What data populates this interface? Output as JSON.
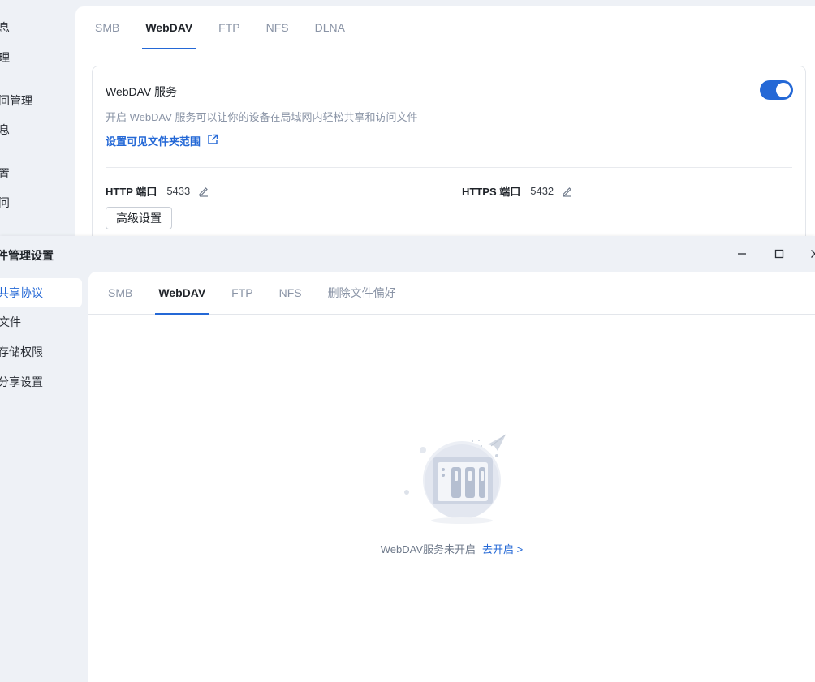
{
  "background_window": {
    "sidebar_items": [
      "息",
      "理",
      "间管理",
      "息",
      "置",
      "问"
    ],
    "tabs": [
      "SMB",
      "WebDAV",
      "FTP",
      "NFS",
      "DLNA"
    ],
    "active_tab": "WebDAV",
    "service": {
      "title": "WebDAV 服务",
      "description": "开启 WebDAV 服务可以让你的设备在局域网内轻松共享和访问文件",
      "folder_link": "设置可见文件夹范围",
      "enabled": true
    },
    "http_port": {
      "label": "HTTP 端口",
      "value": "5433"
    },
    "https_port": {
      "label": "HTTPS 端口",
      "value": "5432"
    },
    "advanced_button": "高级设置"
  },
  "foreground_window": {
    "title": "件管理设置",
    "sidebar_items": [
      "共享协议",
      "文件",
      "存储权限",
      "分享设置"
    ],
    "active_sidebar": "共享协议",
    "tabs": [
      "SMB",
      "WebDAV",
      "FTP",
      "NFS",
      "删除文件偏好"
    ],
    "active_tab": "WebDAV",
    "empty_state": {
      "message": "WebDAV服务未开启",
      "action": "去开启 >"
    },
    "window_controls": [
      "minimize-icon",
      "maximize-icon",
      "close-icon"
    ]
  },
  "colors": {
    "accent": "#2468d6",
    "background": "#eef1f6",
    "panel": "#ffffff",
    "muted_text": "#8a94a6"
  }
}
